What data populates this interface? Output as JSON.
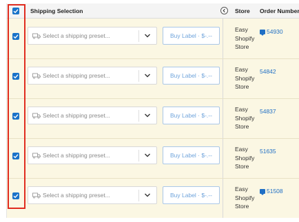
{
  "header": {
    "shipping_selection": "Shipping Selection",
    "store": "Store",
    "order_number": "Order Number",
    "select_all_checked": true
  },
  "rows": [
    {
      "checked": true,
      "preset_placeholder": "Select a shipping preset...",
      "buy_label": "Buy Label · $-.--",
      "store_lines": [
        "Easy",
        "Shopify",
        "Store"
      ],
      "order_number": "54930",
      "has_note": true
    },
    {
      "checked": true,
      "preset_placeholder": "Select a shipping preset...",
      "buy_label": "Buy Label · $-.--",
      "store_lines": [
        "Easy",
        "Shopify",
        "Store"
      ],
      "order_number": "54842",
      "has_note": false
    },
    {
      "checked": true,
      "preset_placeholder": "Select a shipping preset...",
      "buy_label": "Buy Label · $-.--",
      "store_lines": [
        "Easy",
        "Shopify",
        "Store"
      ],
      "order_number": "54837",
      "has_note": false
    },
    {
      "checked": true,
      "preset_placeholder": "Select a shipping preset...",
      "buy_label": "Buy Label · $-.--",
      "store_lines": [
        "Easy",
        "Shopify",
        "Store"
      ],
      "order_number": "51635",
      "has_note": false
    },
    {
      "checked": true,
      "preset_placeholder": "Select a shipping preset...",
      "buy_label": "Buy Label · $-.--",
      "store_lines": [
        "Easy",
        "Shopify",
        "Store"
      ],
      "order_number": "51508",
      "has_note": true
    }
  ],
  "colors": {
    "accent": "#1a73c9",
    "row_background": "#fbf7e3",
    "highlight_border": "#e02b1f",
    "link": "#1f6fc5"
  },
  "icons": {
    "checkbox": "check-icon",
    "preset": "truck-icon",
    "dropdown": "chevron-down-icon",
    "collapse": "chevron-left-icon",
    "order_note": "note-icon"
  }
}
